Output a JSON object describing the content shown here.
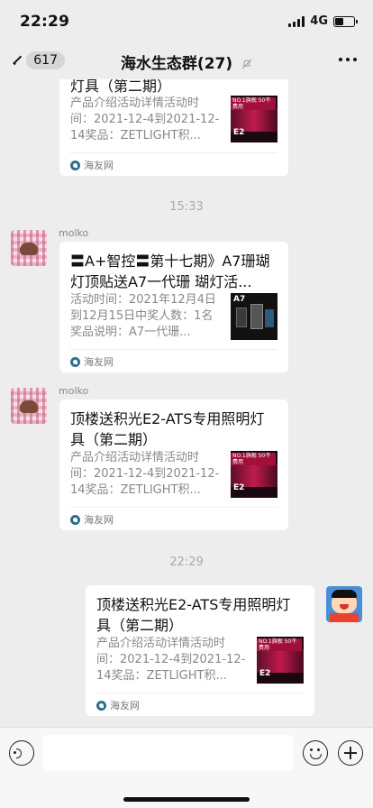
{
  "status_bar": {
    "time": "22:29",
    "network": "4G"
  },
  "nav": {
    "back_count": "617",
    "title": "海水生态群(27)"
  },
  "messages": [
    {
      "title": "灯具（第二期）",
      "desc": "产品介绍活动详情活动时间：2021-12-4到2021-12-14奖品：ZETLIGHT积...",
      "source": "海友网",
      "thumb_label": "E2",
      "thumb_badge": "NO.1旗舰 50不费用"
    },
    {
      "timestamp": "15:33"
    },
    {
      "sender": "molko",
      "title": "〓A+智控〓第十七期》A7珊瑚灯顶贴送A7一代珊 瑚灯活...",
      "desc": "活动时间：2021年12月4日到12月15日中奖人数：1名奖品说明：A7一代珊...",
      "source": "海友网",
      "thumb_label": "A7"
    },
    {
      "sender": "molko",
      "title": "顶楼送积光E2-ATS专用照明灯具（第二期）",
      "desc": "产品介绍活动详情活动时间：2021-12-4到2021-12-14奖品：ZETLIGHT积...",
      "source": "海友网",
      "thumb_label": "E2",
      "thumb_badge": "NO.1旗舰 50不费用"
    },
    {
      "timestamp": "22:29"
    },
    {
      "title": "顶楼送积光E2-ATS专用照明灯具（第二期）",
      "desc": "产品介绍活动详情活动时间：2021-12-4到2021-12-14奖品：ZETLIGHT积...",
      "source": "海友网",
      "thumb_label": "E2",
      "thumb_badge": "NO.1旗舰 50不费用"
    }
  ],
  "input": {
    "value": ""
  },
  "colors": {
    "background": "#ededed",
    "card": "#ffffff",
    "timestamp": "#aaaaaa"
  },
  "icons": [
    "back-chevron-icon",
    "mute-bell-icon",
    "more-icon",
    "voice-icon",
    "emoji-icon",
    "plus-icon"
  ]
}
